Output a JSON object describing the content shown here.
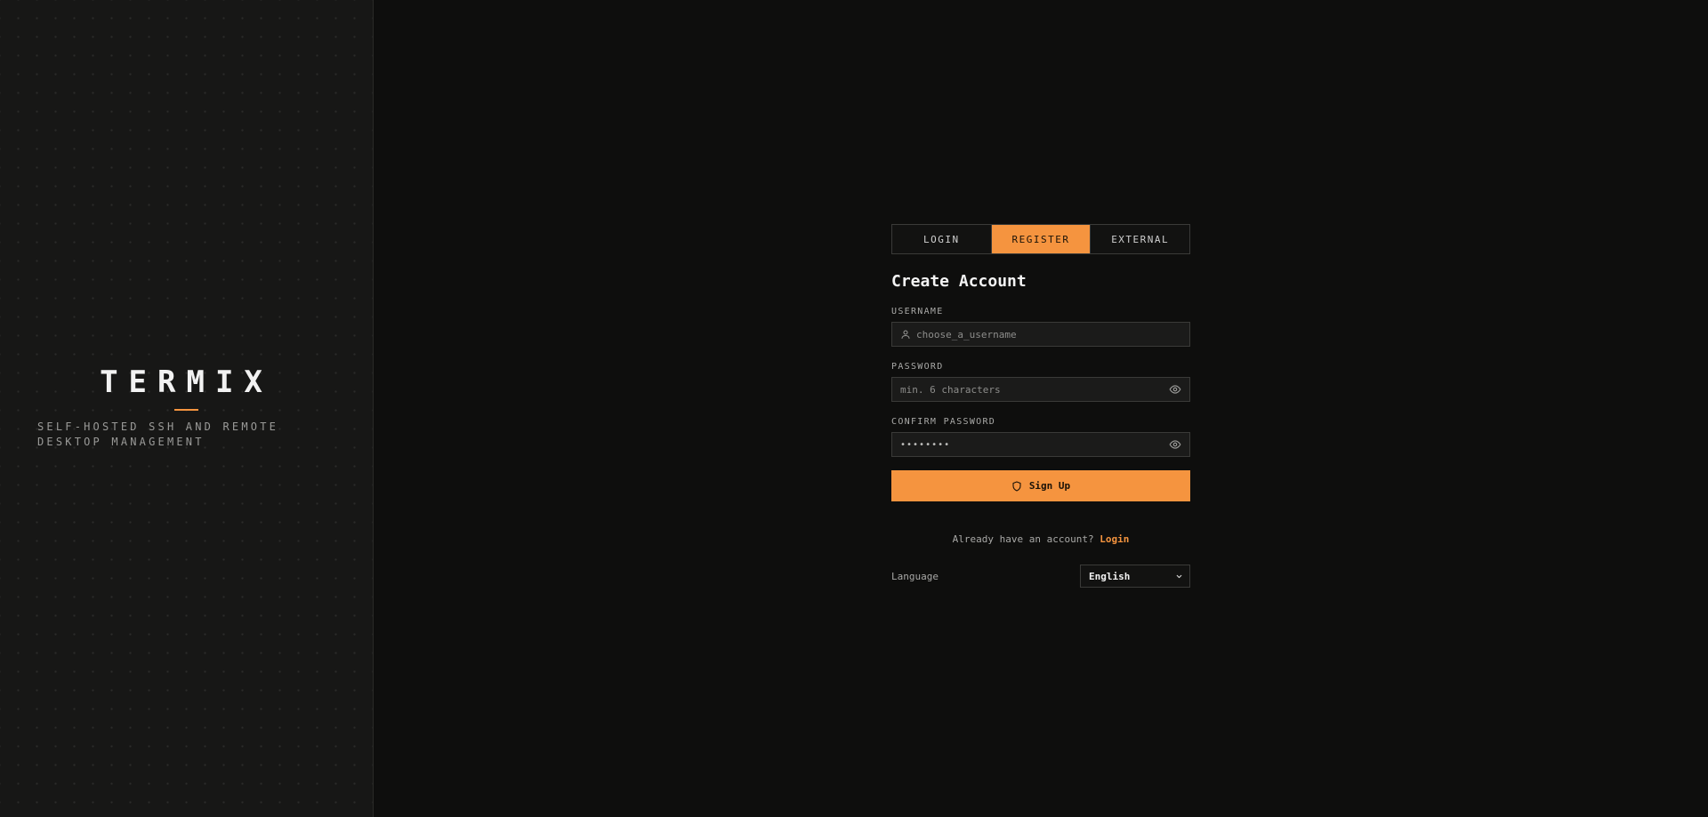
{
  "brand": {
    "title": "TERMIX",
    "tagline": "SELF-HOSTED SSH AND REMOTE DESKTOP MANAGEMENT"
  },
  "tabs": [
    {
      "label": "LOGIN",
      "active": false
    },
    {
      "label": "REGISTER",
      "active": true
    },
    {
      "label": "EXTERNAL",
      "active": false
    }
  ],
  "form": {
    "heading": "Create Account",
    "username": {
      "label": "USERNAME",
      "placeholder": "choose_a_username",
      "value": "",
      "icon": "user-icon"
    },
    "password": {
      "label": "PASSWORD",
      "placeholder": "min. 6 characters",
      "value": "",
      "icon": "eye-icon"
    },
    "confirm_password": {
      "label": "CONFIRM PASSWORD",
      "masked_value": "••••••••",
      "icon": "eye-icon"
    },
    "submit_label": "Sign Up",
    "submit_icon": "shield-icon"
  },
  "footer": {
    "prompt": "Already have an account?",
    "link_label": "Login",
    "language_label": "Language",
    "language_value": "English"
  },
  "colors": {
    "accent": "#f5943f",
    "background": "#0e0e0d",
    "panel_left": "#171716"
  }
}
